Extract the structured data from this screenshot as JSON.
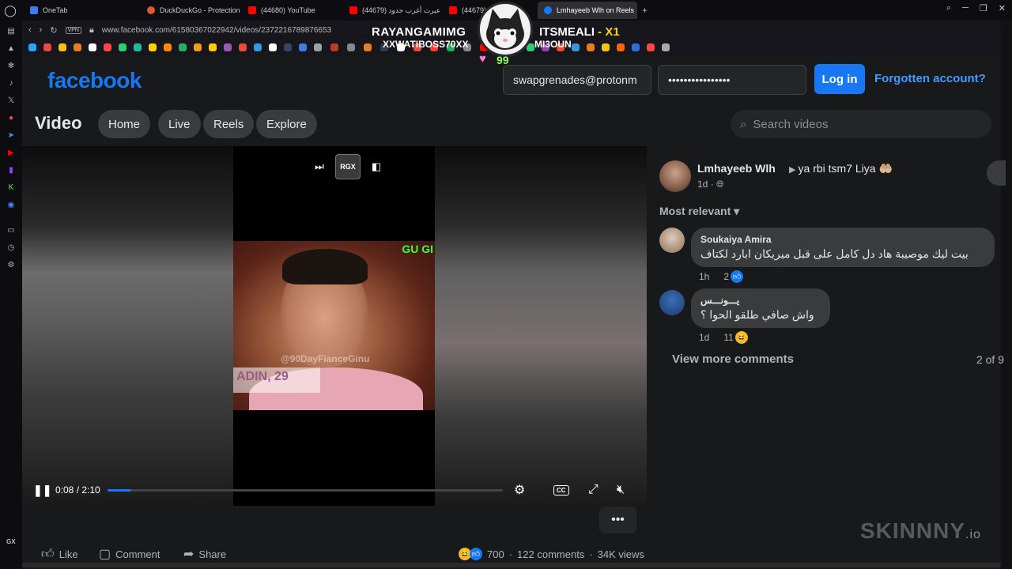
{
  "browser": {
    "tabs": [
      {
        "label": "OneTab",
        "color": "#3b7ded"
      },
      {
        "label": "DuckDuckGo - Protection",
        "color": "#de5833"
      },
      {
        "label": "(44680) YouTube",
        "color": "#ff0000"
      },
      {
        "label": "(44679) عبرت أغرب حدود",
        "color": "#ff0000"
      },
      {
        "label": "(44679)",
        "color": "#ff0000"
      },
      {
        "label": "Lmhayeeb Wlh on Reels",
        "color": "#1877f2"
      }
    ],
    "url": "www.facebook.com/61580367022942/videos/2372216789876653",
    "vpn_label": "VPN",
    "new_tab": "+"
  },
  "overlay": {
    "left_name": "RAYANGAMIMG",
    "left_sub": "XXWATIBOSS70XX",
    "right_name": "ITSMEALI",
    "right_badge": "- X1",
    "right_sub": "MI3OUN",
    "count": "99"
  },
  "header": {
    "logo": "facebook",
    "email_value": "swapgrenades@protonm",
    "password_value": "••••••••••••••••",
    "login_label": "Log in",
    "forgot_label": "Forgotten account?"
  },
  "videonav": {
    "title": "Video",
    "tabs": [
      "Home",
      "Live",
      "Reels",
      "Explore"
    ],
    "search_placeholder": "Search videos"
  },
  "player": {
    "overlay_text": "GU GI",
    "watermark": "@90DayFianceGinu",
    "name_tag": "ADIN, 29",
    "rgx_label": "RGX",
    "time": "0:08 / 2:10",
    "progress": 0.06,
    "cc_label": "CC"
  },
  "actions": {
    "like": "Like",
    "comment": "Comment",
    "share": "Share",
    "reactions_count": "700",
    "comments_count": "122 comments",
    "views": "34K views",
    "more": "•••"
  },
  "post": {
    "author": "Lmhayeeb Wlh",
    "caption": "ya rbi tsm7 Liya 🤲🏼",
    "age": "1d",
    "sort_label": "Most relevant",
    "comments": [
      {
        "name": "Soukaiya Amira",
        "text": "بيت ليك موصيبة هاد دل كامل على قبل ميريكان ابارد لكتاف",
        "age": "1h",
        "reactions": "2"
      },
      {
        "name": "يـــونـــس",
        "text": "واش صافي طلقو الحوا ؟",
        "age": "1d",
        "reactions": "11"
      }
    ],
    "view_more": "View more comments",
    "paging": "2 of 9"
  },
  "brand": {
    "name": "SKINNNY",
    "tld": ".io"
  },
  "colors": {
    "fb_blue": "#1877f2",
    "bg": "#18191a",
    "surface": "#242526"
  }
}
